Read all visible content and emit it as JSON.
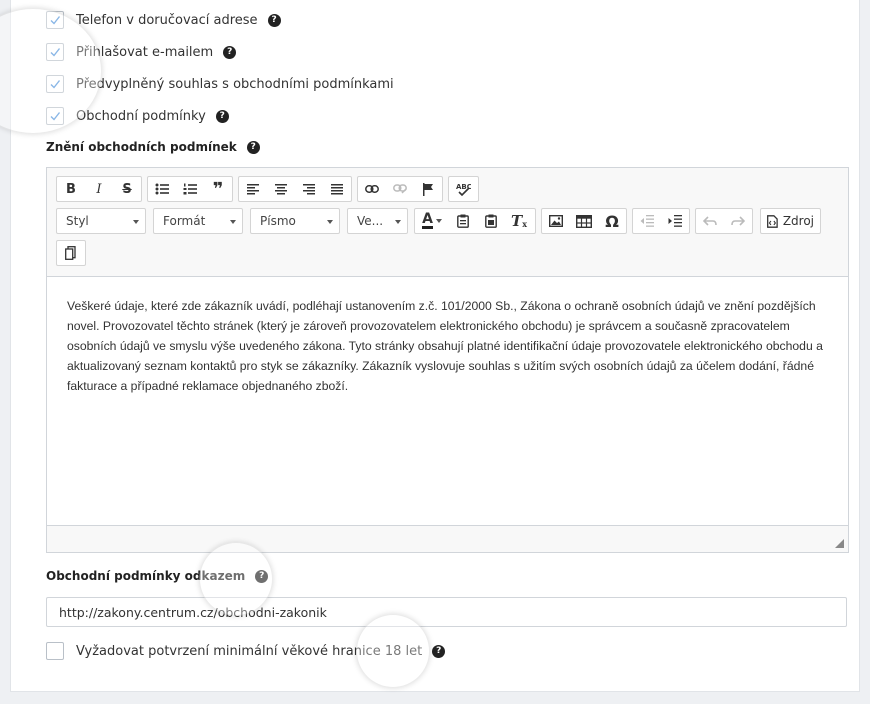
{
  "checkboxes": [
    {
      "label": "Telefon v doručovací adrese",
      "checked": true,
      "help": true
    },
    {
      "label": "Přihlašovat e-mailem",
      "checked": true,
      "help": true
    },
    {
      "label": "Předvyplněný souhlas s obchodními podmínkami",
      "checked": true,
      "help": false
    },
    {
      "label": "Obchodní podmínky",
      "checked": true,
      "help": true
    }
  ],
  "terms_heading": "Znění obchodních podmínek",
  "help_glyph": "?",
  "toolbar": {
    "bold": "B",
    "italic": "I",
    "strike": "S",
    "blockquote": "❞",
    "combo_style": "Styl",
    "combo_format": "Formát",
    "combo_font": "Písmo",
    "combo_size": "Ve...",
    "font_color": "A",
    "clear_format": "T",
    "omega": "Ω",
    "source_label": "Zdroj"
  },
  "editor_text": "Veškeré údaje, které zde zákazník uvádí, podléhají ustanovením z.č. 101/2000 Sb., Zákona o ochraně osobních údajů ve znění pozdějších novel. Provozovatel těchto stránek (který je zároveň provozovatelem elektronického obchodu) je správcem a současně zpracovatelem osobních údajů ve smyslu výše uvedeného zákona. Tyto stránky obsahují platné identifikační údaje provozovatele elektronického obchodu a aktualizovaný seznam kontaktů pro styk se zákazníky. Zákazník vyslovuje souhlas s užitím svých osobních údajů za účelem dodání, řádné fakturace a případné reklamace objednaného zboží.",
  "link_heading": "Obchodní podmínky odkazem",
  "link_url": "http://zakony.centrum.cz/obchodni-zakonik",
  "age_checkbox": {
    "label": "Vyžadovat potvrzení minimální věkové hranice 18 let",
    "checked": false
  },
  "colors": {
    "check": "#4a90d9",
    "border": "#d1d5da",
    "toolbar_bg": "#f8f8f8"
  }
}
